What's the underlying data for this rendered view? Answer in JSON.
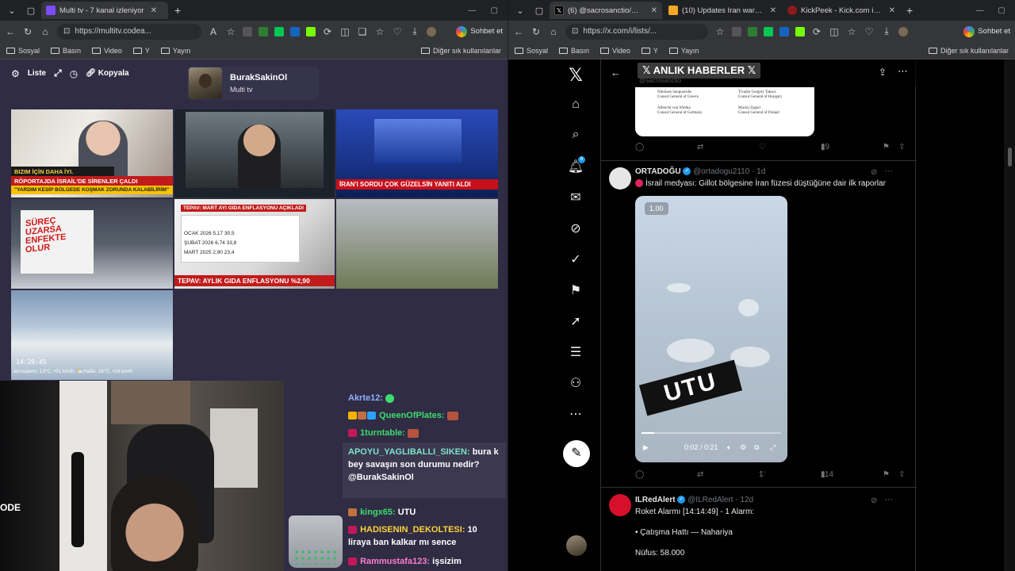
{
  "left_window": {
    "tabs": [
      {
        "title": "Multi tv - 7 kanal izleniyor",
        "active": true
      }
    ],
    "url": "https://multitv.codea...",
    "sohbet": "Sohbet et",
    "bookmarks": [
      "Sosyal",
      "Basın",
      "Video",
      "Y",
      "Yayın"
    ],
    "bookmarks_other": "Diğer sık kullanılanlar",
    "page": {
      "controls": {
        "list": "Liste",
        "copy": "Kopyala"
      },
      "profile": {
        "name": "BurakSakinOl",
        "subtitle": "Multi tv"
      },
      "tiles": {
        "t1": {
          "b1": "BIZIM İÇİN DAHA İYI.",
          "b2": "RÖPORTAJDA İSRAİL'DE SİRENLER ÇALDI",
          "b3": "\"YARDIM KESİP BÖLGEDE KOŞMAK ZORUNDA KALABİLİRİM\""
        },
        "t3": {
          "b1": "İRAN'I SORDU ÇOK GÜZELSİN YANITI ALDI"
        },
        "t4": {
          "h": "SÜREÇ UZARSA ENFEKTE OLUR"
        },
        "t5": {
          "hd": "TEPAV: MART AYI GIDA ENFLASYONU AÇIKLADI",
          "rows": [
            "OCAK 2026   5,17   30,5",
            "ŞUBAT 2026   6,74   33,8",
            "MART 2025   2,90   23,4"
          ],
          "b1": "TEPAV: AYLIK GIDA ENFLASYONU %2,90"
        },
        "t7": {
          "clock": "14:29:45",
          "weather": "Jerusalem: 13°C, •31 km/h, ⛅Haifa: 16°C, •24 km/h"
        }
      }
    },
    "webcam_text": "ODE",
    "chat": [
      {
        "user": "Akrte12:",
        "color": "#8fb0ff",
        "text": ""
      },
      {
        "user": "QueenOfPlates:",
        "color": "#3ddc6e",
        "text": ""
      },
      {
        "user": "1turntable:",
        "color": "#3ddc6e",
        "text": ""
      },
      {
        "user": "APOYU_YAGLIBALLI_SIKEN:",
        "color": "#7fe3c9",
        "text": "bura k bey savaşın son durumu nedir? @BurakSakinOl"
      },
      {
        "user": "kingx65:",
        "color": "#3ddc6e",
        "text": "UTU"
      },
      {
        "user": "HADISENIN_DEKOLTESI:",
        "color": "#ffd23a",
        "text": "10 liraya ban kalkar mı sence"
      },
      {
        "user": "Rammustafa123:",
        "color": "#ff7bd0",
        "text": "işsizim"
      }
    ]
  },
  "right_window": {
    "tabs": [
      {
        "title": "(6) @sacrosanctio/𝕏 ANLIK HA",
        "active": true
      },
      {
        "title": "(10) Updates Iran war live: Tru",
        "active": false
      },
      {
        "title": "KickPeek - Kick.com için Gerçe",
        "active": false
      }
    ],
    "url": "https://x.com/i/lists/...",
    "sohbet": "Sohbet et",
    "bookmarks": [
      "Sosyal",
      "Basın",
      "Video",
      "Y",
      "Yayın"
    ],
    "bookmarks_other": "Diğer sık kullanılanlar",
    "nav_badge": "6",
    "list_title": "𝕏 ANLIK HABERLER 𝕏",
    "list_sub": "@sacrosanctio",
    "doc": {
      "l1": "Nikolaos Sangouridis",
      "l2": "Consul General of Greece",
      "r1": "Tivadar Gergely Takacs",
      "r2": "Consul General of Hungary",
      "l3": "Albrecht von Wietka",
      "l4": "Consul General of Germany",
      "r3": "Maciej Zagiel",
      "r4": "Consul General of Poland"
    },
    "post0_actions": {
      "views": "19"
    },
    "post1": {
      "name": "ORTADOĞU",
      "handle": "@ortadogu2110 · 1d",
      "text": "İsrail medyası: Gillot bölgesine İran füzesi düştüğüne dair ilk raporlar",
      "video": {
        "speed": "1.00",
        "stamp": "UTU",
        "time": "0:02 / 0:21"
      },
      "likes": "1",
      "views": "114"
    },
    "post2": {
      "name": "ILRedAlert",
      "handle": "@ILRedAlert · 12d",
      "line1": "Roket Alarmı [14:14:49] - 1 Alarm:",
      "line2": "• Çatışma Hattı — Nahariya",
      "line3": "Nüfus: 58.000"
    }
  }
}
